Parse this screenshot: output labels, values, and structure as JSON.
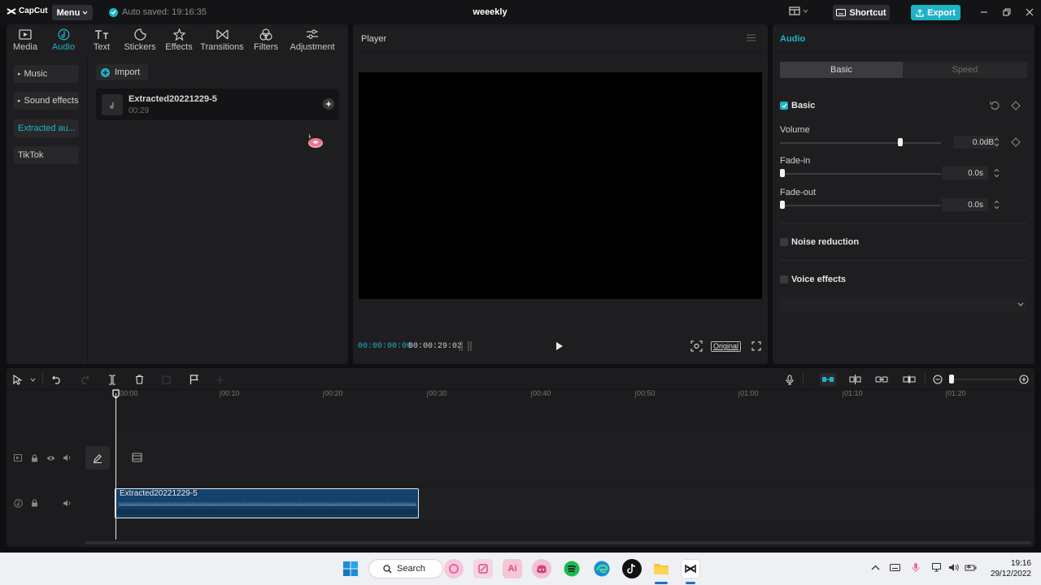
{
  "app": {
    "logo_text": "CapCut",
    "menu_label": "Menu",
    "autosave_text": "Auto saved: 19:16:35",
    "project_title": "weeekly",
    "shortcut_label": "Shortcut",
    "export_label": "Export"
  },
  "tabs": [
    {
      "label": "Media",
      "icon": "media-icon",
      "active": false
    },
    {
      "label": "Audio",
      "icon": "audio-icon",
      "active": true
    },
    {
      "label": "Text",
      "icon": "text-icon",
      "active": false
    },
    {
      "label": "Stickers",
      "icon": "sticker-icon",
      "active": false
    },
    {
      "label": "Effects",
      "icon": "effects-icon",
      "active": false
    },
    {
      "label": "Transitions",
      "icon": "transitions-icon",
      "active": false
    },
    {
      "label": "Filters",
      "icon": "filters-icon",
      "active": false
    },
    {
      "label": "Adjustment",
      "icon": "adjustment-icon",
      "active": false
    }
  ],
  "categories": [
    {
      "label": "Music",
      "arrow": true,
      "active": false
    },
    {
      "label": "Sound effects",
      "arrow": true,
      "active": false
    },
    {
      "label": "Extracted au...",
      "arrow": false,
      "active": true
    },
    {
      "label": "TikTok",
      "arrow": false,
      "active": false
    }
  ],
  "library": {
    "import_label": "Import",
    "items": [
      {
        "name": "Extracted20221229-5",
        "duration": "00:29"
      }
    ]
  },
  "player": {
    "title": "Player",
    "current_time": "00:00:00:00",
    "total_time": "00:00:29:02",
    "ratio_label": "Original"
  },
  "inspector": {
    "title": "Audio",
    "tab_basic": "Basic",
    "tab_speed": "Speed",
    "basic_section": "Basic",
    "volume_label": "Volume",
    "volume_value": "0.0dB",
    "volume_level": 0.5,
    "fadein_label": "Fade-in",
    "fadein_value": "0.0s",
    "fadeout_label": "Fade-out",
    "fadeout_value": "0.0s",
    "noise_reduction_label": "Noise reduction",
    "voice_effects_label": "Voice effects"
  },
  "timeline": {
    "ruler": [
      "00:00",
      "00:10",
      "00:20",
      "00:30",
      "00:40",
      "00:50",
      "01:00",
      "01:10",
      "01:20"
    ],
    "clip_name": "Extracted20221229-5"
  },
  "taskbar": {
    "search_label": "Search",
    "time": "19:16",
    "date": "29/12/2022"
  },
  "colors": {
    "accent": "#1fb2c4",
    "clip": "#14426b",
    "panel": "#1e1e20"
  }
}
